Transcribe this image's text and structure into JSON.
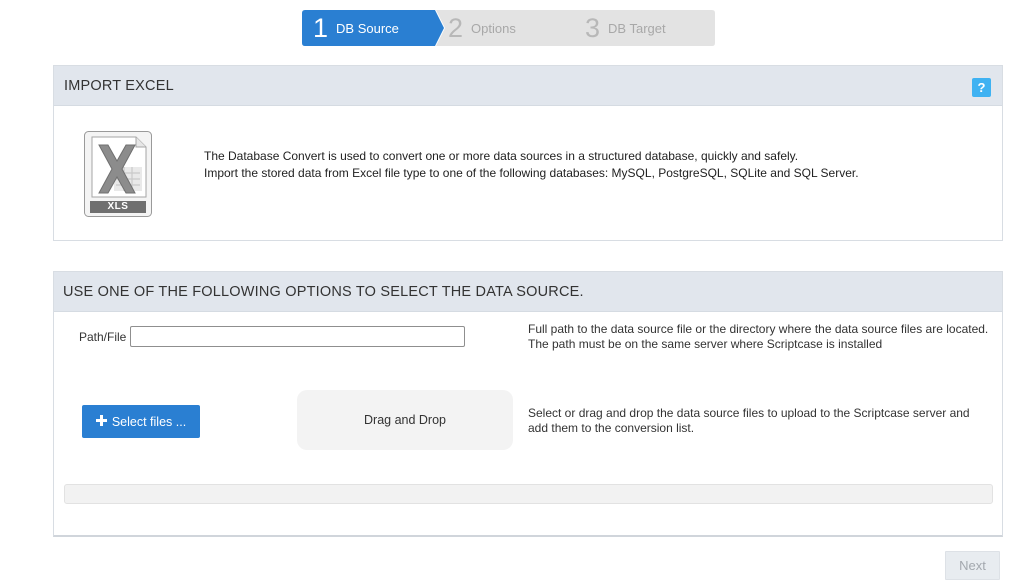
{
  "wizard": {
    "steps": [
      {
        "number": "1",
        "label": "DB Source",
        "state": "active"
      },
      {
        "number": "2",
        "label": "Options",
        "state": "inactive"
      },
      {
        "number": "3",
        "label": "DB Target",
        "state": "inactive"
      }
    ],
    "colors": {
      "active": "#2a7fd2",
      "inactive": "#e3e3e3"
    }
  },
  "import_panel": {
    "title": "IMPORT EXCEL",
    "help_label": "?",
    "icon": {
      "name": "excel-xls-icon",
      "badge": "XLS"
    },
    "description_line1": "The Database Convert is used to convert one or more data sources in a structured database, quickly and safely.",
    "description_line2": "Import the stored data from Excel file type to one of the following databases: MySQL, PostgreSQL, SQLite and SQL Server."
  },
  "source_panel": {
    "title": "USE ONE OF THE FOLLOWING OPTIONS TO SELECT THE DATA SOURCE.",
    "path_label": "Path/File",
    "path_value": "",
    "path_help_line1": "Full path to the data source file or the directory where the data source files are located.",
    "path_help_line2": "The path must be on the same server where Scriptcase is installed",
    "select_files_label": "Select files ...",
    "select_files_icon": "plus-icon",
    "dropzone_label": "Drag and Drop",
    "upload_help_line1": "Select or drag and drop the data source files to upload to the Scriptcase server and",
    "upload_help_line2": "add them to the conversion list.",
    "upload_progress": 0
  },
  "footer": {
    "next_label": "Next",
    "next_enabled": false
  }
}
